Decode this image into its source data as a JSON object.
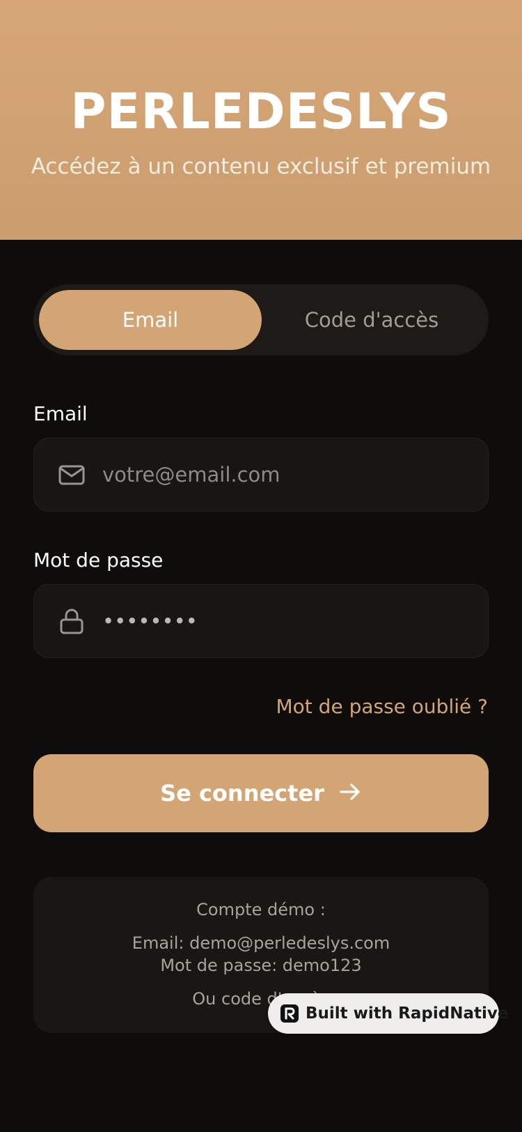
{
  "header": {
    "brand": "PERLEDESLYS",
    "tagline": "Accédez à un contenu exclusif et premium"
  },
  "tabs": [
    {
      "label": "Email",
      "selected": true
    },
    {
      "label": "Code d'accès",
      "selected": false
    }
  ],
  "form": {
    "email_label": "Email",
    "email_placeholder": "votre@email.com",
    "password_label": "Mot de passe",
    "password_value": "••••••••",
    "forgot_link": "Mot de passe oublié ?",
    "submit_label": "Se connecter"
  },
  "demo": {
    "title": "Compte démo :",
    "email_line": "Email: demo@perledeslys.com",
    "password_line": "Mot de passe: demo123",
    "code_line": "Ou code d'accès"
  },
  "badge": {
    "label": "Built with RapidNative"
  },
  "icons": {
    "email": "mail-icon",
    "password": "lock-icon",
    "submit": "arrow-right-icon",
    "badge": "rapidnative-logo-icon"
  },
  "colors": {
    "accent": "#d4a574",
    "background": "#0e0d0c",
    "field_background": "#171615",
    "muted_text": "#a39b94"
  }
}
